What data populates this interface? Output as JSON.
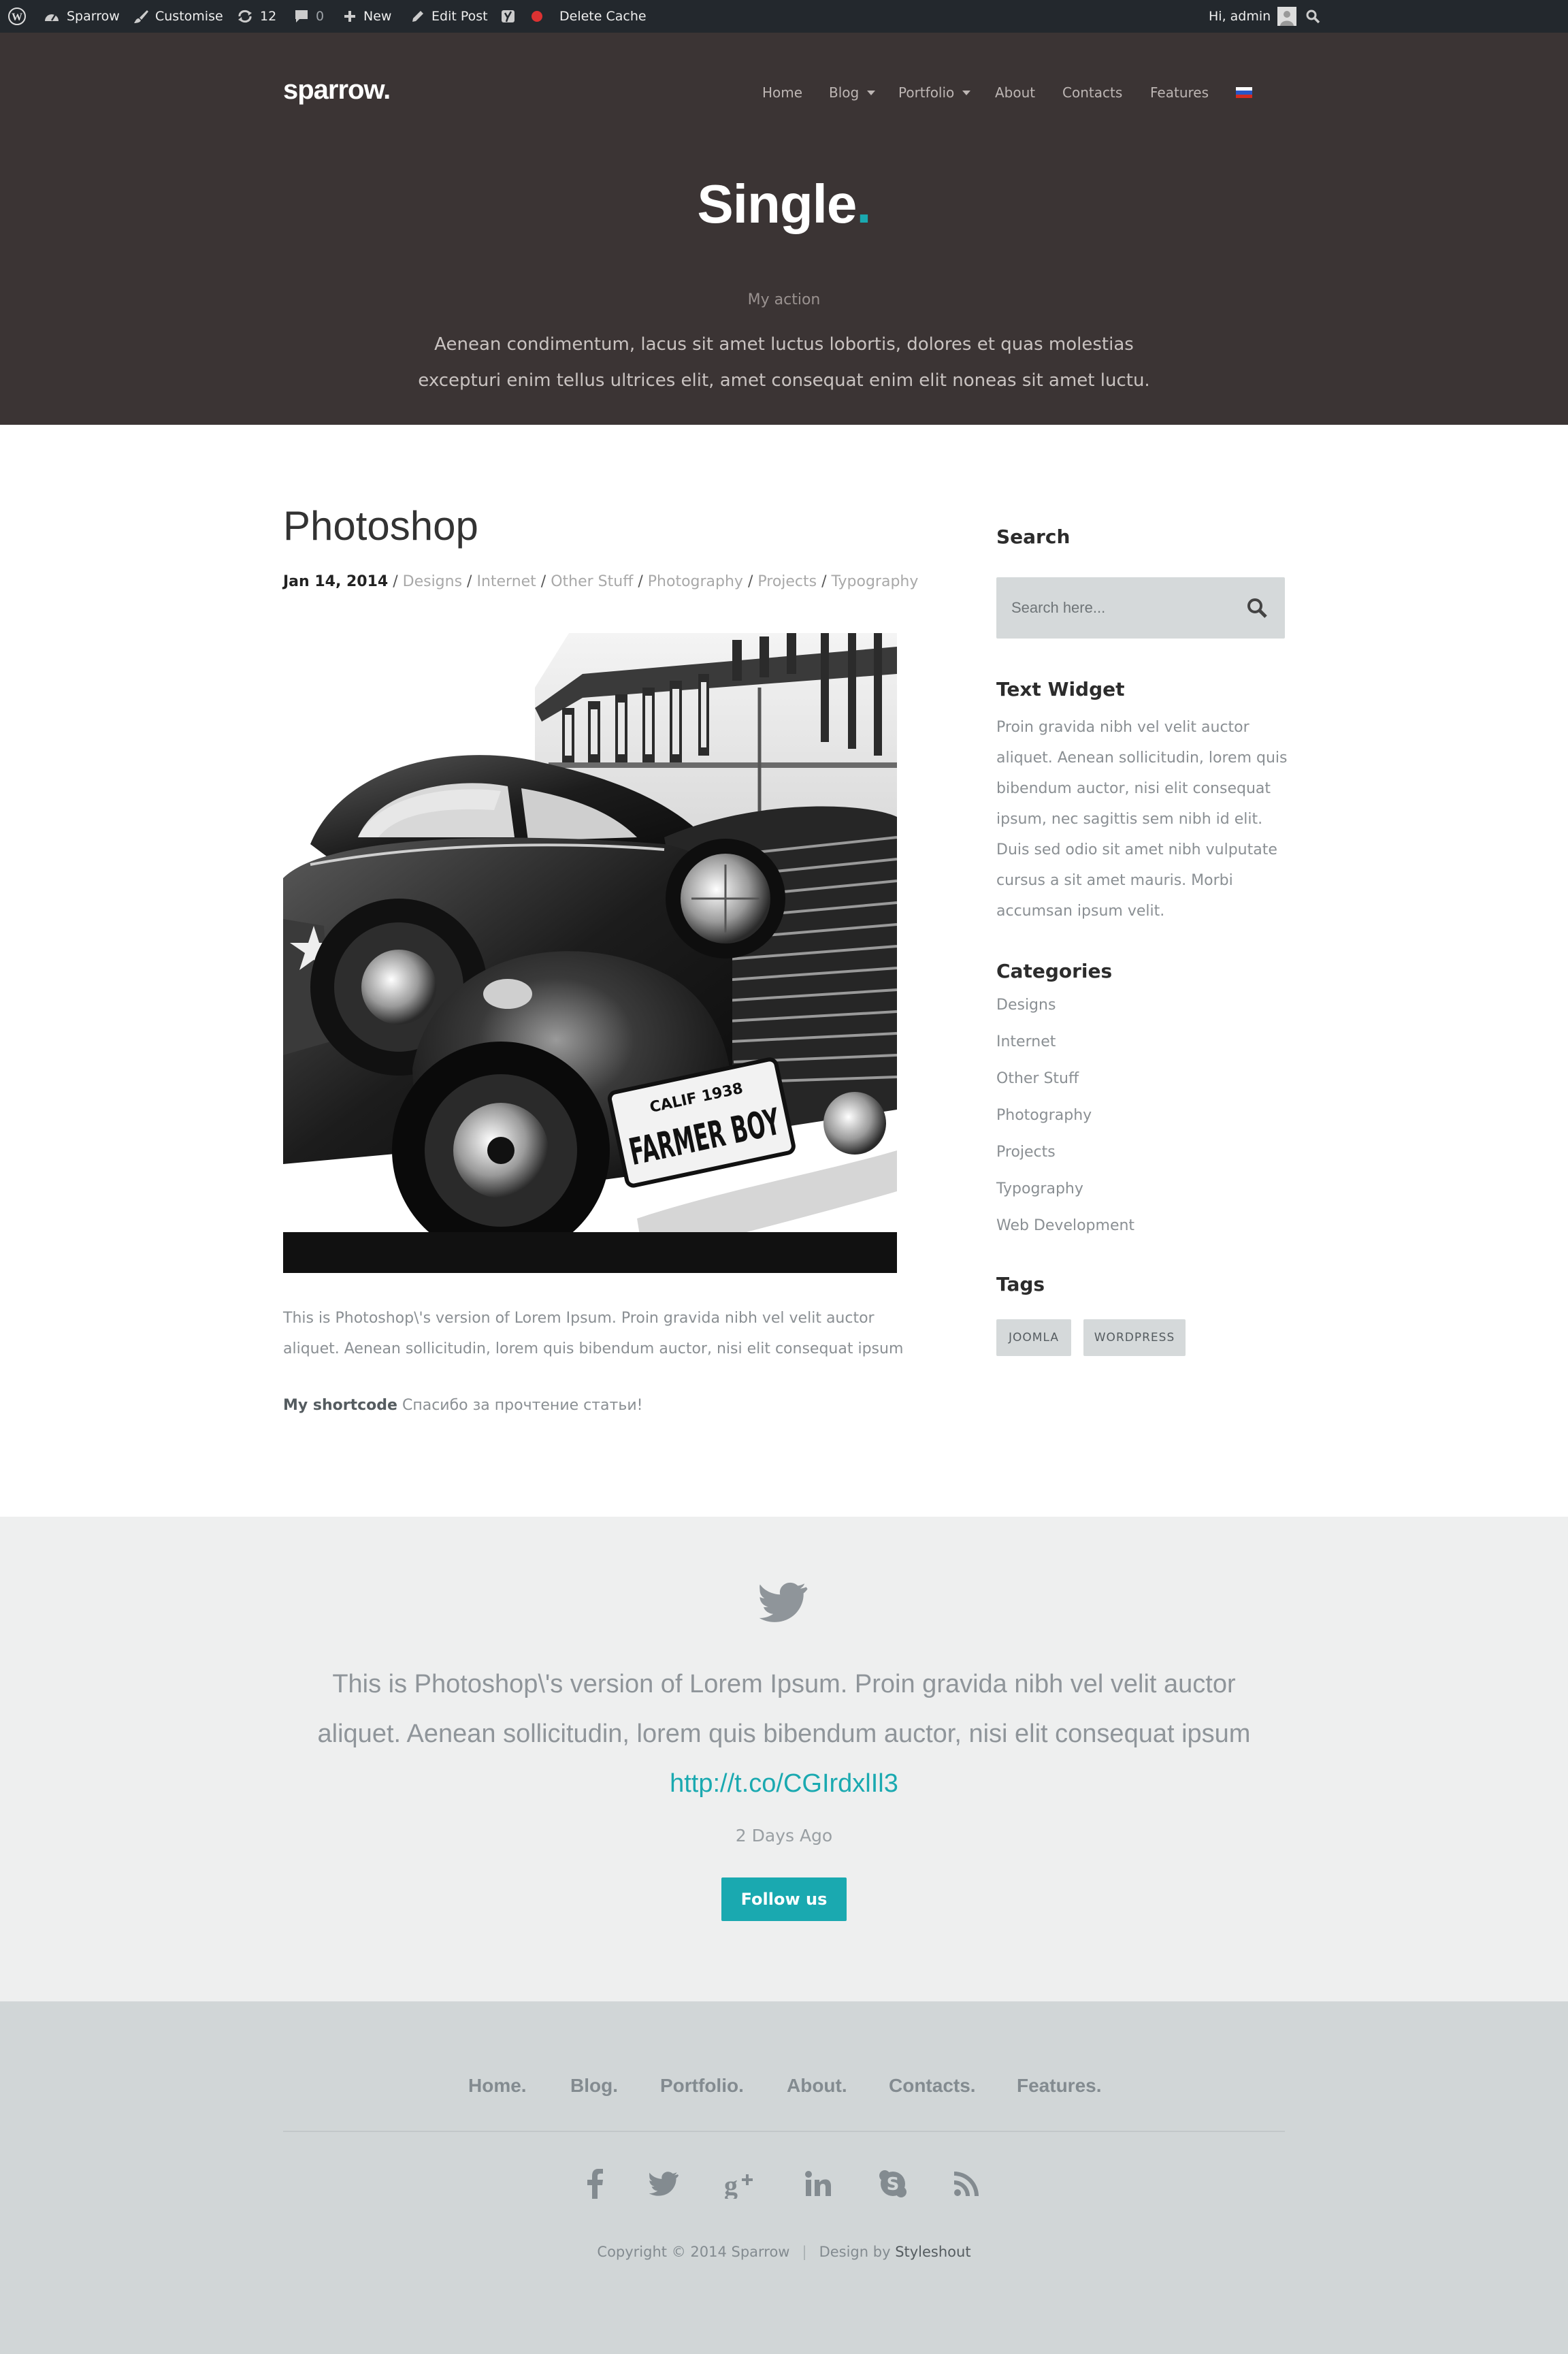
{
  "admin_bar": {
    "site_name": "Sparrow",
    "customise": "Customise",
    "updates_count": "12",
    "comments_count": "0",
    "new_label": "New",
    "edit_post": "Edit Post",
    "delete_cache": "Delete Cache",
    "greeting": "Hi, admin"
  },
  "header": {
    "logo": "sparrow.",
    "nav": [
      "Home",
      "Blog",
      "Portfolio",
      "About",
      "Contacts",
      "Features"
    ],
    "title": "Single",
    "title_dot": ".",
    "subtitle": "My action",
    "description": "Aenean condimentum, lacus sit amet luctus lobortis, dolores et quas molestias excepturi enim tellus ultrices elit, amet consequat enim elit noneas sit amet luctu."
  },
  "post": {
    "title": "Photoshop",
    "date": "Jan 14, 2014",
    "sep": " / ",
    "categories": [
      "Designs",
      "Internet",
      "Other Stuff",
      "Photography",
      "Projects",
      "Typography"
    ],
    "text": "This is Photoshop\\'s version of Lorem Ipsum. Proin gravida nibh vel velit auctor aliquet. Aenean sollicitudin, lorem quis bibendum auctor, nisi elit consequat ipsum",
    "shortcode_label": "My shortcode",
    "shortcode_text": " Спасибо за прочтение статьи!",
    "image_plate_top": "CALIF 1938",
    "image_plate": "FARMER BOY"
  },
  "sidebar": {
    "search_title": "Search",
    "search_placeholder": "Search here...",
    "text_widget_title": "Text Widget",
    "text_widget_body": "Proin gravida nibh vel velit auctor aliquet. Aenean sollicitudin, lorem quis bibendum auctor, nisi elit consequat ipsum, nec sagittis sem nibh id elit. Duis sed odio sit amet nibh vulputate cursus a sit amet mauris. Morbi accumsan ipsum velit.",
    "categories_title": "Categories",
    "categories": [
      "Designs",
      "Internet",
      "Other Stuff",
      "Photography",
      "Projects",
      "Typography",
      "Web Development"
    ],
    "tags_title": "Tags",
    "tags": [
      "JOOMLA",
      "WORDPRESS"
    ]
  },
  "twitter": {
    "tweet": "This is Photoshop\\'s version of Lorem Ipsum. Proin gravida nibh vel velit auctor aliquet. Aenean sollicitudin, lorem quis bibendum auctor, nisi elit consequat ipsum ",
    "link": "http://t.co/CGIrdxlIl3",
    "time": "2 Days Ago",
    "follow": "Follow us",
    "icon": "twitter-icon"
  },
  "footer": {
    "nav": [
      "Home.",
      "Blog.",
      "Portfolio.",
      "About.",
      "Contacts.",
      "Features."
    ],
    "social_icons": [
      "facebook-icon",
      "twitter-icon",
      "google-plus-icon",
      "linkedin-icon",
      "skype-icon",
      "rss-icon"
    ],
    "copyright": "Copyright © 2014 Sparrow",
    "separator": "|",
    "design_by": "Design by ",
    "designer": "Styleshout"
  },
  "colors": {
    "accent": "#1aa9b0",
    "admin_bar": "#23282d",
    "hero_bg": "#3b3434",
    "twitter_bg": "#eeefef",
    "footer_bg": "#d1d6d7"
  }
}
